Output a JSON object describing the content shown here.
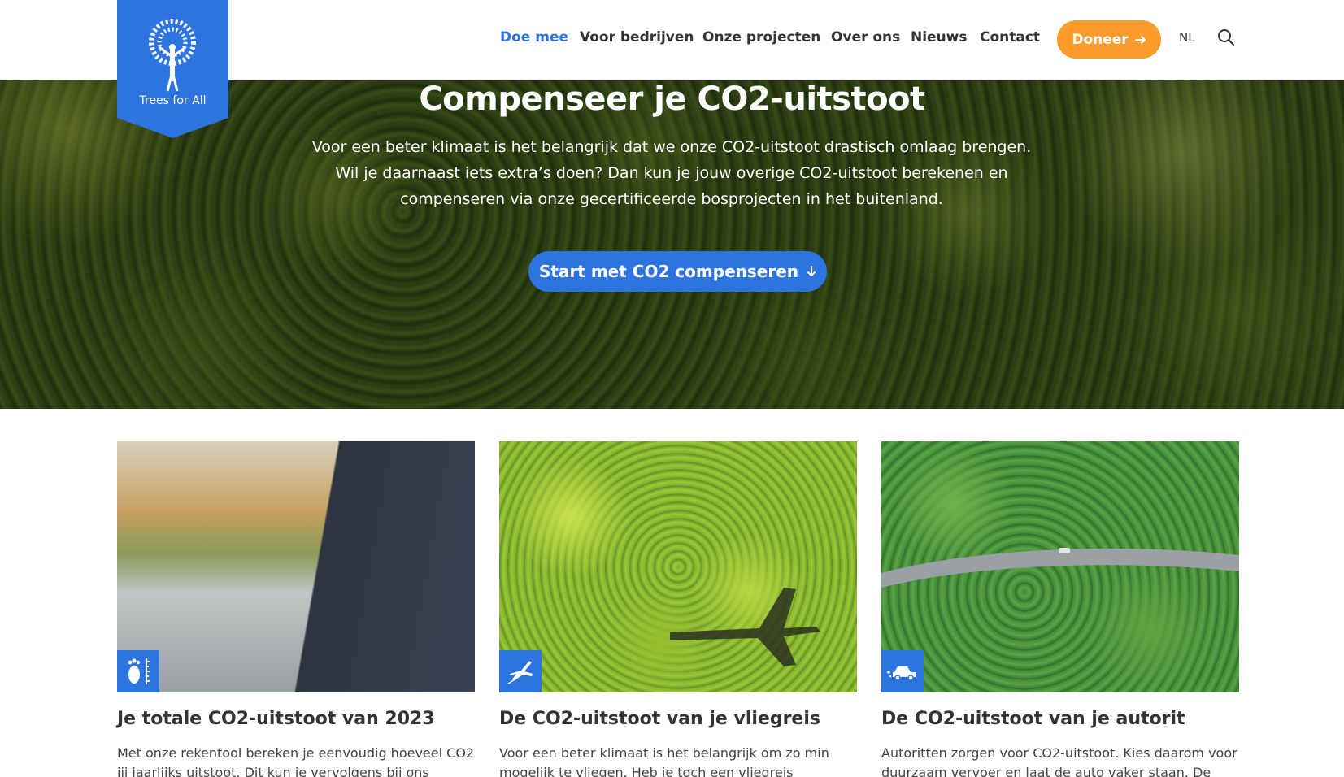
{
  "brand": {
    "name": "Trees for All",
    "color": "#2d74e0"
  },
  "nav": {
    "items": [
      {
        "label": "Doe mee",
        "active": true
      },
      {
        "label": "Voor bedrijven",
        "active": false
      },
      {
        "label": "Onze projecten",
        "active": false
      },
      {
        "label": "Over ons",
        "active": false
      },
      {
        "label": "Nieuws",
        "active": false
      },
      {
        "label": "Contact",
        "active": false
      }
    ],
    "donate_label": "Doneer",
    "donate_color": "#fb9b2c",
    "language": "NL",
    "search_icon": "search-icon"
  },
  "hero": {
    "title": "Compenseer je CO2-uitstoot",
    "text_line1": "Voor een beter klimaat is het belangrijk dat we onze CO2-uitstoot drastisch omlaag brengen.",
    "text_line2": "Wil je daarnaast iets extra’s doen? Dan kun je jouw overige CO2-uitstoot berekenen en",
    "text_line3": "compenseren via onze gecertificeerde bosprojecten in het buitenland.",
    "button_label": "Start met CO2 compenseren"
  },
  "cards": [
    {
      "title": "Je totale CO2-uitstoot van 2023",
      "text": "Met onze rekentool bereken je eenvoudig hoeveel CO2 jij jaarlijks uitstoot. Dit kun je vervolgens bij ons",
      "icon": "footprint-icon"
    },
    {
      "title": "De CO2-uitstoot van je vliegreis",
      "text": "Voor een beter klimaat is het belangrijk om zo min mogelijk te vliegen. Heb je toch een vliegreis gemaakt?",
      "icon": "airplane-icon"
    },
    {
      "title": "De CO2-uitstoot van je autorit",
      "text": "Autoritten zorgen voor CO2-uitstoot. Kies daarom voor duurzaam vervoer en laat de auto vaker staan. De",
      "icon": "car-icon"
    }
  ]
}
